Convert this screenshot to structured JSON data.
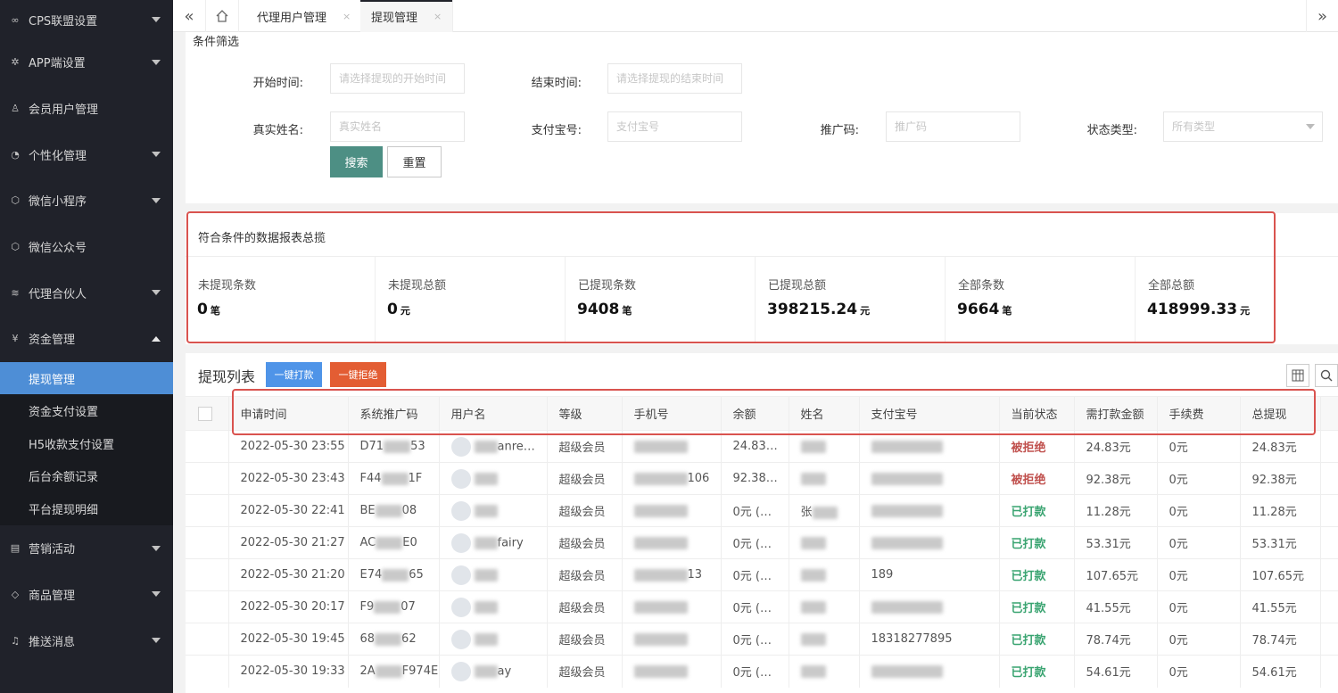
{
  "sidebar": {
    "items": [
      {
        "icon": "link-icon",
        "glyph": "∞",
        "label": "CPS联盟设置",
        "arrow": "down"
      },
      {
        "icon": "gear-icon",
        "glyph": "✲",
        "label": "APP端设置",
        "arrow": "down"
      },
      {
        "icon": "user-icon",
        "glyph": "♙",
        "label": "会员用户管理",
        "arrow": ""
      },
      {
        "icon": "palette-icon",
        "glyph": "◔",
        "label": "个性化管理",
        "arrow": "down"
      },
      {
        "icon": "cube-icon",
        "glyph": "⬡",
        "label": "微信小程序",
        "arrow": "down"
      },
      {
        "icon": "cube-icon",
        "glyph": "⬡",
        "label": "微信公众号",
        "arrow": ""
      },
      {
        "icon": "layers-icon",
        "glyph": "≋",
        "label": "代理合伙人",
        "arrow": "down"
      },
      {
        "icon": "yen-icon",
        "glyph": "¥",
        "label": "资金管理",
        "arrow": "up"
      }
    ],
    "sub_items": [
      "提现管理",
      "资金支付设置",
      "H5收款支付设置",
      "后台余额记录",
      "平台提现明细"
    ],
    "items_after": [
      {
        "icon": "calendar-icon",
        "glyph": "▤",
        "label": "营销活动",
        "arrow": "down"
      },
      {
        "icon": "tag-icon",
        "glyph": "◇",
        "label": "商品管理",
        "arrow": "down"
      },
      {
        "icon": "bell-icon",
        "glyph": "♫",
        "label": "推送消息",
        "arrow": "down"
      }
    ]
  },
  "tabbar": {
    "prev": "«",
    "next": "»",
    "tabs": [
      {
        "label": "代理用户管理",
        "close": "×"
      },
      {
        "label": "提现管理",
        "close": "×"
      }
    ]
  },
  "filter": {
    "title": "条件筛选",
    "start_label": "开始时间:",
    "start_placeholder": "请选择提现的开始时间",
    "end_label": "结束时间:",
    "end_placeholder": "请选择提现的结束时间",
    "name_label": "真实姓名:",
    "name_placeholder": "真实姓名",
    "alipay_label": "支付宝号:",
    "alipay_placeholder": "支付宝号",
    "promo_label": "推广码:",
    "promo_placeholder": "推广码",
    "status_label": "状态类型:",
    "status_placeholder": "所有类型",
    "search_btn": "搜索",
    "reset_btn": "重置"
  },
  "summary": {
    "title": "符合条件的数据报表总揽",
    "stats": [
      {
        "label": "未提现条数",
        "value": "0",
        "unit": "笔"
      },
      {
        "label": "未提现总额",
        "value": "0",
        "unit": "元"
      },
      {
        "label": "已提现条数",
        "value": "9408",
        "unit": "笔"
      },
      {
        "label": "已提现总额",
        "value": "398215.24",
        "unit": "元"
      },
      {
        "label": "全部条数",
        "value": "9664",
        "unit": "笔"
      },
      {
        "label": "全部总额",
        "value": "418999.33",
        "unit": "元"
      }
    ]
  },
  "list": {
    "title": "提现列表",
    "pay_all_btn": "一键打款",
    "reject_all_btn": "一键拒绝",
    "columns": [
      "申请时间",
      "系统推广码",
      "用户名",
      "等级",
      "手机号",
      "余额",
      "姓名",
      "支付宝号",
      "当前状态",
      "需打款金额",
      "手续费",
      "总提现"
    ],
    "rows": [
      {
        "time": "2022-05-30 23:55",
        "code": "D71",
        "code2": "53",
        "user": "anre…",
        "level": "超级会员",
        "phone": "",
        "balance": "24.83…",
        "name": "",
        "alipay": "",
        "status": "被拒绝",
        "status_type": "rejected",
        "amount": "24.83元",
        "fee": "0元",
        "total": "24.83元"
      },
      {
        "time": "2022-05-30 23:43",
        "code": "F44",
        "code2": "1F",
        "user": "",
        "level": "超级会员",
        "phone": "106",
        "balance": "92.38…",
        "name": "",
        "alipay": "",
        "status": "被拒绝",
        "status_type": "rejected",
        "amount": "92.38元",
        "fee": "0元",
        "total": "92.38元"
      },
      {
        "time": "2022-05-30 22:41",
        "code": "BE",
        "code2": "08",
        "user": "",
        "level": "超级会员",
        "phone": "",
        "balance": "0元 (…",
        "name": "张",
        "alipay": "",
        "status": "已打款",
        "status_type": "paid",
        "amount": "11.28元",
        "fee": "0元",
        "total": "11.28元"
      },
      {
        "time": "2022-05-30 21:27",
        "code": "AC",
        "code2": "E0",
        "user": "fairy",
        "level": "超级会员",
        "phone": "",
        "balance": "0元 (…",
        "name": "",
        "alipay": "",
        "status": "已打款",
        "status_type": "paid",
        "amount": "53.31元",
        "fee": "0元",
        "total": "53.31元"
      },
      {
        "time": "2022-05-30 21:20",
        "code": "E74",
        "code2": "65",
        "user": "",
        "level": "超级会员",
        "phone": "13",
        "balance": "0元 (…",
        "name": "",
        "alipay": "189",
        "status": "已打款",
        "status_type": "paid",
        "amount": "107.65元",
        "fee": "0元",
        "total": "107.65元"
      },
      {
        "time": "2022-05-30 20:17",
        "code": "F9",
        "code2": "07",
        "user": "",
        "level": "超级会员",
        "phone": "",
        "balance": "0元 (…",
        "name": "",
        "alipay": "",
        "status": "已打款",
        "status_type": "paid",
        "amount": "41.55元",
        "fee": "0元",
        "total": "41.55元"
      },
      {
        "time": "2022-05-30 19:45",
        "code": "68",
        "code2": "62",
        "user": "",
        "level": "超级会员",
        "phone": "",
        "balance": "0元 (…",
        "name": "",
        "alipay": "18318277895",
        "status": "已打款",
        "status_type": "paid",
        "amount": "78.74元",
        "fee": "0元",
        "total": "78.74元"
      },
      {
        "time": "2022-05-30 19:33",
        "code": "2A",
        "code2": "F974E",
        "user": "ay",
        "level": "超级会员",
        "phone": "",
        "balance": "0元 (…",
        "name": "",
        "alipay": "",
        "status": "已打款",
        "status_type": "paid",
        "amount": "54.61元",
        "fee": "0元",
        "total": "54.61元"
      }
    ]
  },
  "colors": {
    "sidebar_bg": "#20222a",
    "active_menu": "#4e8ed6",
    "search_btn": "#4d8f84",
    "pay_btn": "#4f94e8",
    "reject_btn": "#e35d33",
    "status_rejected": "#c0504d",
    "status_paid": "#3aa471",
    "highlight_box": "#d9534f"
  }
}
